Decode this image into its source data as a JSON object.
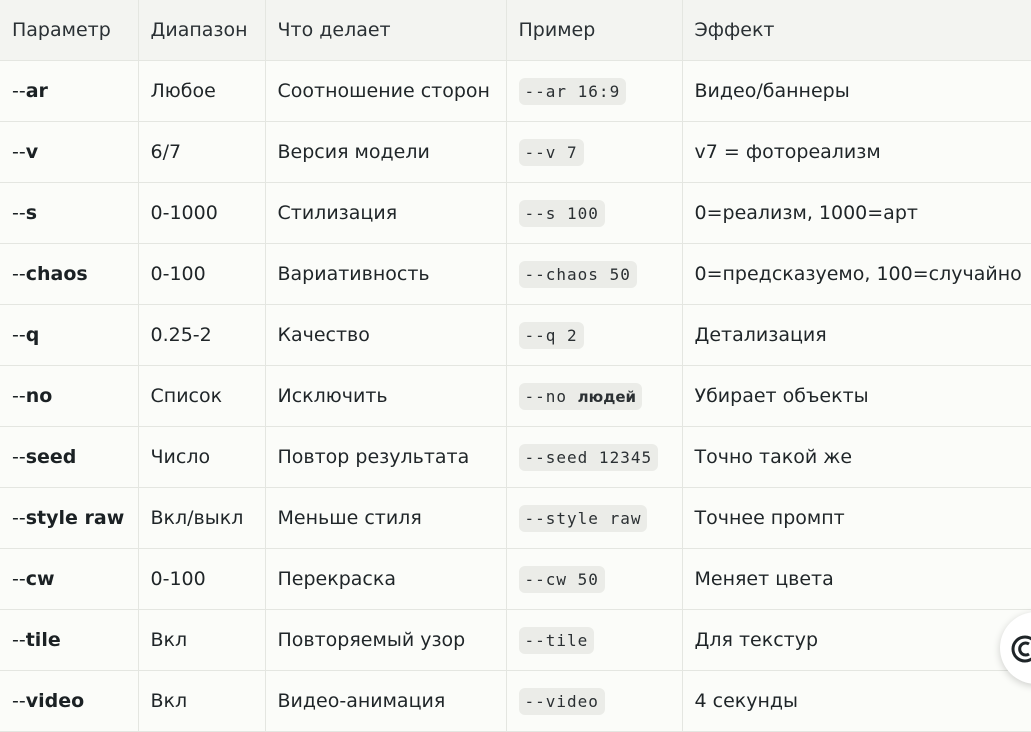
{
  "table": {
    "headers": [
      "Параметр",
      "Диапазон",
      "Что делает",
      "Пример",
      "Эффект"
    ],
    "rows": [
      {
        "param": "ar",
        "range": "Любое",
        "does": "Соотношение сторон",
        "example": "--ar 16:9",
        "effect": "Видео/баннеры"
      },
      {
        "param": "v",
        "range": "6/7",
        "does": "Версия модели",
        "example": "--v 7",
        "effect": "v7 = фотореализм"
      },
      {
        "param": "s",
        "range": "0-1000",
        "does": "Стилизация",
        "example": "--s 100",
        "effect": "0=реализм, 1000=арт"
      },
      {
        "param": "chaos",
        "range": "0-100",
        "does": "Вариативность",
        "example": "--chaos 50",
        "effect": "0=предсказуемо, 100=случайно"
      },
      {
        "param": "q",
        "range": "0.25-2",
        "does": "Качество",
        "example": "--q 2",
        "effect": "Детализация"
      },
      {
        "param": "no",
        "range": "Список",
        "does": "Исключить",
        "example": "--no",
        "example_bold": "людей",
        "effect": "Убирает объекты"
      },
      {
        "param": "seed",
        "range": "Число",
        "does": "Повтор результата",
        "example": "--seed 12345",
        "effect": "Точно такой же"
      },
      {
        "param": "style raw",
        "range": "Вкл/выкл",
        "does": "Меньше стиля",
        "example": "--style raw",
        "effect": "Точнее промпт"
      },
      {
        "param": "cw",
        "range": "0-100",
        "does": "Перекраска",
        "example": "--cw 50",
        "effect": "Меняет цвета"
      },
      {
        "param": "tile",
        "range": "Вкл",
        "does": "Повторяемый узор",
        "example": "--tile",
        "effect": "Для текстур"
      },
      {
        "param": "video",
        "range": "Вкл",
        "does": "Видео-анимация",
        "example": "--video",
        "effect": "4 секунды"
      }
    ]
  },
  "param_prefix": "--",
  "floating_button": {
    "icon": "copy-icon"
  }
}
